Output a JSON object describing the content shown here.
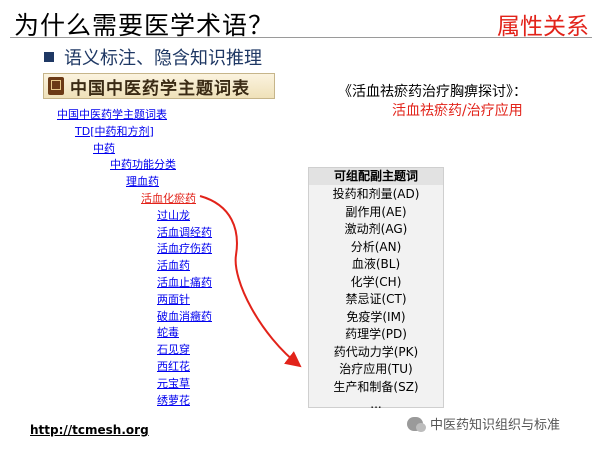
{
  "slide": {
    "title": "为什么需要医学术语？",
    "section_label": "属性关系",
    "subheading": "语义标注、隐含知识推理"
  },
  "banner": {
    "title": "中国中医药学主题词表",
    "icon": "book-icon"
  },
  "tree": {
    "nodes": [
      {
        "label": "中国中医药学主题词表",
        "level": 0
      },
      {
        "label": "TD[中药和方剂]",
        "level": 1
      },
      {
        "label": "中药",
        "level": 2
      },
      {
        "label": "中药功能分类",
        "level": 3
      },
      {
        "label": "理血药",
        "level": 4
      },
      {
        "label": "活血化瘀药",
        "level": 5,
        "selected": true
      },
      {
        "label": "过山龙",
        "level": 6
      },
      {
        "label": "活血调经药",
        "level": 6
      },
      {
        "label": "活血疗伤药",
        "level": 6
      },
      {
        "label": "活血药",
        "level": 6
      },
      {
        "label": "活血止痛药",
        "level": 6
      },
      {
        "label": "两面针",
        "level": 6
      },
      {
        "label": "破血消癥药",
        "level": 6
      },
      {
        "label": "蛇毒",
        "level": 6
      },
      {
        "label": "石见穿",
        "level": 6
      },
      {
        "label": "西红花",
        "level": 6
      },
      {
        "label": "元宝草",
        "level": 6
      },
      {
        "label": "绣萝花",
        "level": 6
      }
    ]
  },
  "paper": {
    "title": "《活血祛瘀药治疗胸痹探讨》：",
    "subject": "活血祛瘀药/治疗应用"
  },
  "qualifiers": {
    "header": "可组配副主题词",
    "items": [
      "投药和剂量(AD)",
      "副作用(AE)",
      "激动剂(AG)",
      "分析(AN)",
      "血液(BL)",
      "化学(CH)",
      "禁忌证(CT)",
      "免疫学(IM)",
      "药理学(PD)",
      "药代动力学(PK)",
      "治疗应用(TU)",
      "生产和制备(SZ)",
      "..."
    ]
  },
  "footer": {
    "url": "http://tcmesh.org",
    "watermark": "中医药知识组织与标准",
    "watermark_icon": "wechat-icon"
  },
  "colors": {
    "accent_red": "#e2231a",
    "link_blue": "#0000ee",
    "heading_navy": "#1f3864"
  }
}
